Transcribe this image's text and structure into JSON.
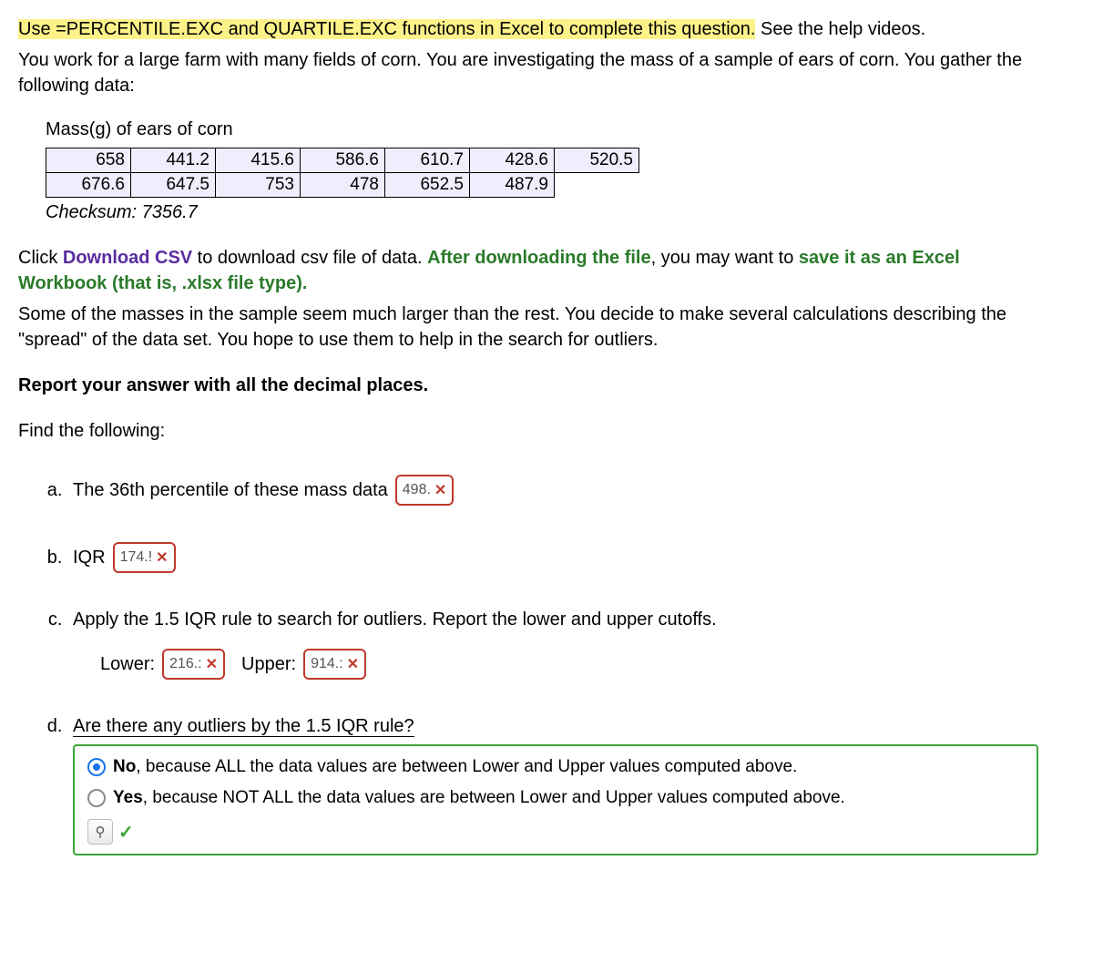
{
  "intro": {
    "highlighted": "Use =PERCENTILE.EXC and QUARTILE.EXC functions in Excel to complete this question.",
    "after_hl": " See the help videos.",
    "line2": "You work for a large farm with many fields of corn. You are investigating the mass of a sample of ears of corn. You gather the following data:"
  },
  "table": {
    "title": "Mass(g) of ears of corn",
    "row1": [
      "658",
      "441.2",
      "415.6",
      "586.6",
      "610.7",
      "428.6",
      "520.5"
    ],
    "row2": [
      "676.6",
      "647.5",
      "753",
      "478",
      "652.5",
      "487.9"
    ],
    "checksum": "Checksum: 7356.7"
  },
  "download": {
    "pre": "Click ",
    "link": "Download CSV",
    "mid": " to download csv file of data. ",
    "green1": "After downloading the file",
    "mid2": ", you may want to ",
    "green2": "save it as an Excel Workbook (that is, .xlsx file type)."
  },
  "spread_text": "Some of the masses in the sample seem much larger than the rest. You decide to make several calculations describing the \"spread\" of the data set. You hope to use them to help in the search for outliers.",
  "report": "Report your answer with all the decimal places.",
  "find": "Find the following:",
  "qa": {
    "text": "The 36th percentile of these mass data",
    "ans": "498."
  },
  "qb": {
    "text": "IQR",
    "ans": "174.!"
  },
  "qc": {
    "text": "Apply the 1.5 IQR rule to search for outliers. Report the lower and upper cutoffs.",
    "lower_label": "Lower:",
    "lower_ans": "216.:",
    "upper_label": "Upper:",
    "upper_ans": "914.:"
  },
  "qd": {
    "text": "Are there any outliers by the 1.5 IQR rule?",
    "opt1_b": "No",
    "opt1_rest": ", because ALL the data values are between Lower and Upper values computed above.",
    "opt2_b": "Yes",
    "opt2_rest": ", because NOT ALL the data values are between Lower and Upper values computed above.",
    "score_icon": "⚄"
  }
}
